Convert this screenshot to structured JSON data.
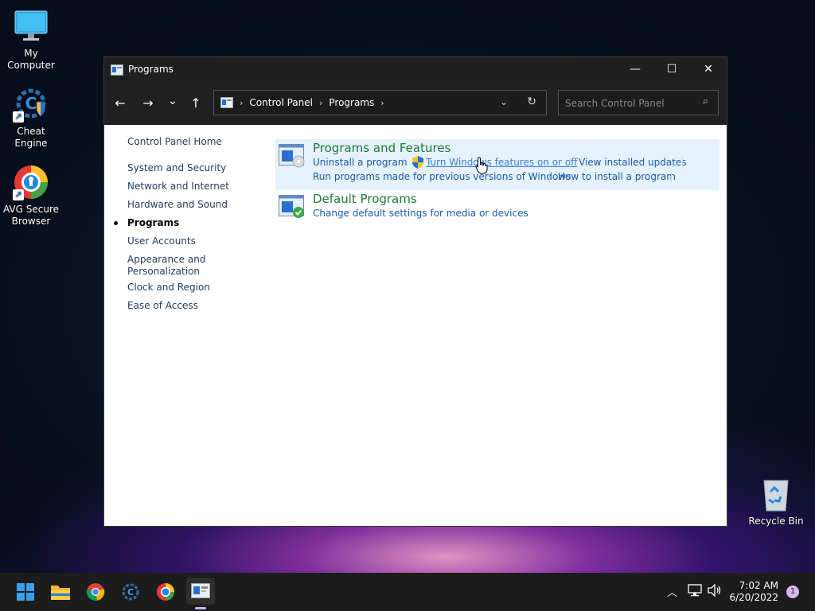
{
  "desktop": {
    "icons": [
      {
        "label": "My Computer"
      },
      {
        "label": "Cheat Engine"
      },
      {
        "label": "AVG Secure Browser"
      },
      {
        "label": "Recycle Bin"
      }
    ]
  },
  "window": {
    "title": "Programs",
    "buttons": {
      "minimize": "—",
      "maximize": "☐",
      "close": "✕"
    }
  },
  "nav": {
    "back": "←",
    "forward": "→",
    "recent": "⌄",
    "up": "↑",
    "breadcrumb": [
      "Control Panel",
      "Programs"
    ],
    "search_placeholder": "Search Control Panel"
  },
  "left_nav": {
    "home": "Control Panel Home",
    "items": [
      "System and Security",
      "Network and Internet",
      "Hardware and Sound",
      "Programs",
      "User Accounts",
      "Appearance and Personalization",
      "Clock and Region",
      "Ease of Access"
    ],
    "active": "Programs"
  },
  "sections": [
    {
      "title": "Programs and Features",
      "links": [
        "Uninstall a program",
        "Turn Windows features on or off",
        "View installed updates",
        "Run programs made for previous versions of Windows",
        "How to install a program"
      ]
    },
    {
      "title": "Default Programs",
      "links": [
        "Change default settings for media or devices"
      ]
    }
  ],
  "taskbar": {
    "time": "7:02 AM",
    "date": "6/20/2022",
    "notifications": "1"
  },
  "colors": {
    "link": "#1a5aa8",
    "section_title": "#1e7b3a",
    "highlight": "#e5f1fb",
    "titlebar": "#1f1f1f"
  }
}
